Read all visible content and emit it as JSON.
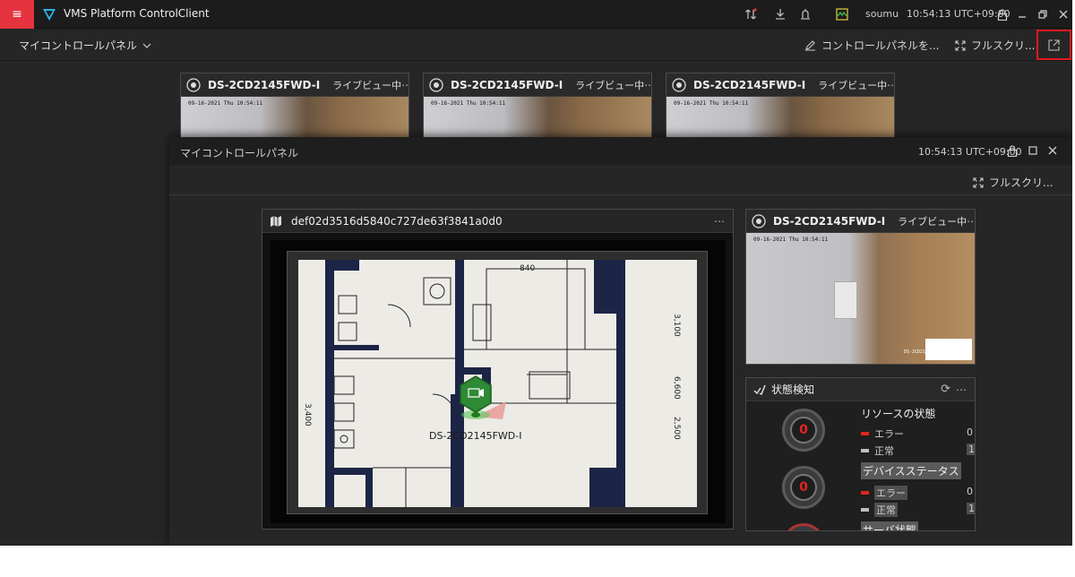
{
  "app": {
    "title": "VMS Platform ControlClient",
    "user": "soumu",
    "time": "10:54:13 UTC+09:00",
    "accent": "#e5333f"
  },
  "subbar": {
    "panel_name": "マイコントロールパネル",
    "edit_label": "コントロールパネルを...",
    "fullscreen_label": "フルスクリ..."
  },
  "background_cameras": [
    {
      "name": "DS-2CD2145FWD-I",
      "status": "ライブビュー中",
      "osd": "09-16-2021 Thu 10:54:11"
    },
    {
      "name": "DS-2CD2145FWD-I",
      "status": "ライブビュー中",
      "osd": "09-16-2021 Thu 10:54:11"
    },
    {
      "name": "DS-2CD2145FWD-I",
      "status": "ライブビュー中",
      "osd": "09-16-2021 Thu 10:54:11"
    }
  ],
  "window": {
    "title": "マイコントロールパネル",
    "time": "10:54:13 UTC+09:00",
    "fullscreen_label": "フルスクリ..."
  },
  "map_panel": {
    "title": "def02d3516d5840c727de63f3841a0d0",
    "camera_label": "DS-2CD2145FWD-I",
    "dimension_labels": [
      "840",
      "3,100",
      "6,600",
      "2,500",
      "3,400"
    ]
  },
  "right_camera": {
    "name": "DS-2CD2145FWD-I",
    "status": "ライブビュー中",
    "osd": "09-16-2021 Thu 10:54:11",
    "corner_label": "DS-2CD214"
  },
  "status_panel": {
    "title": "状態検知",
    "resource": {
      "heading": "リソースの状態",
      "error_label": "エラー",
      "error_count": "0",
      "normal_label": "正常",
      "normal_count": "1",
      "gauge_value": "0"
    },
    "device": {
      "heading": "デバイスステータス",
      "error_label": "エラー",
      "error_count": "0",
      "normal_label": "正常",
      "normal_count": "1",
      "gauge_value": "0"
    },
    "server_heading_partial": "サーバ状態",
    "colors": {
      "error": "#e2241f",
      "normal": "#bfbfbf"
    }
  }
}
